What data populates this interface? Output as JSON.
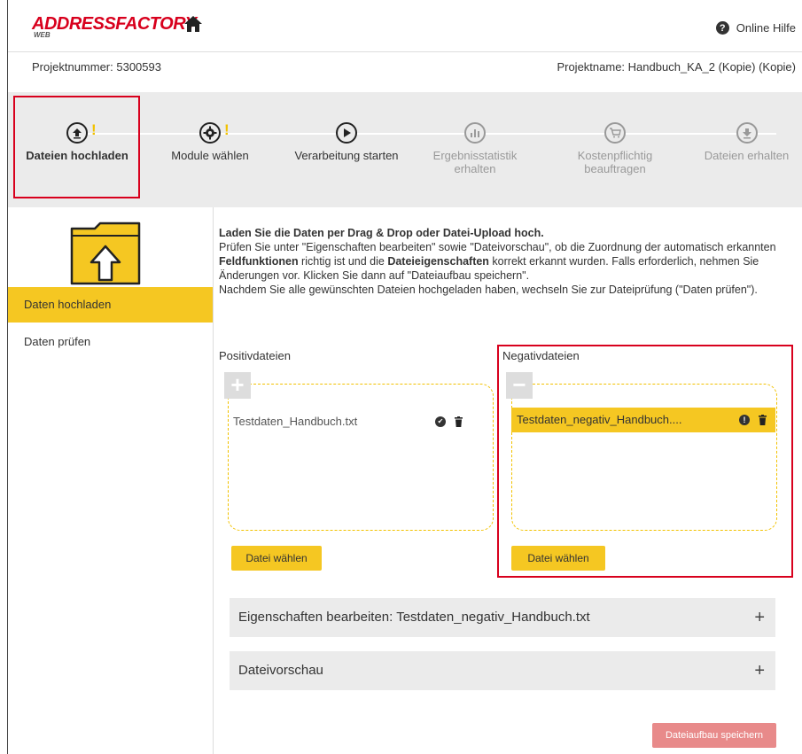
{
  "header": {
    "logo_text": "ADDRESSFACTORY",
    "logo_sub": "WEB",
    "help_label": "Online Hilfe",
    "project_number": "Projektnummer: 5300593",
    "project_name": "Projektname: Handbuch_KA_2 (Kopie) (Kopie)"
  },
  "stepper": {
    "steps": [
      {
        "label": "Dateien hochladen",
        "icon": "upload-icon",
        "state": "active",
        "warning": "!"
      },
      {
        "label": "Module wählen",
        "icon": "gear-icon",
        "state": "normal",
        "warning": "!"
      },
      {
        "label": "Verarbeitung starten",
        "icon": "play-icon",
        "state": "normal"
      },
      {
        "label": "Ergebnisstatistik erhalten",
        "icon": "chart-icon",
        "state": "disabled"
      },
      {
        "label": "Kostenpflichtig beauftragen",
        "icon": "cart-icon",
        "state": "disabled"
      },
      {
        "label": "Dateien erhalten",
        "icon": "download-icon",
        "state": "disabled"
      }
    ]
  },
  "leftnav": {
    "items": [
      {
        "label": "Daten hochladen",
        "active": true
      },
      {
        "label": "Daten prüfen",
        "active": false
      }
    ]
  },
  "intro": {
    "title": "Laden Sie die Daten per Drag & Drop oder Datei-Upload hoch.",
    "p1_a": "Prüfen Sie unter \"Eigenschaften bearbeiten\" sowie \"Dateivorschau\", ob die Zuordnung der automatisch erkannten ",
    "p1_b": "Feldfunktionen",
    "p1_c": " richtig ist und die ",
    "p1_d": "Dateieigenschaften",
    "p1_e": " korrekt erkannt wurden. Falls erforderlich, nehmen Sie Änderungen vor. Klicken Sie dann auf \"Dateiaufbau speichern\".",
    "p2": "Nachdem Sie alle gewünschten Dateien hochgeladen haben, wechseln Sie zur Dateiprüfung (\"Daten prüfen\")."
  },
  "positive": {
    "label": "Positivdateien",
    "add_symbol": "+",
    "file": "Testdaten_Handbuch.txt",
    "choose_label": "Datei wählen"
  },
  "negative": {
    "label": "Negativdateien",
    "remove_symbol": "−",
    "file": "Testdaten_negativ_Handbuch....",
    "choose_label": "Datei wählen"
  },
  "accordions": {
    "properties": "Eigenschaften bearbeiten: Testdaten_negativ_Handbuch.txt",
    "preview": "Dateivorschau",
    "toggle": "+"
  },
  "footer": {
    "save_label": "Dateiaufbau speichern"
  },
  "colors": {
    "brand_red": "#d8001d",
    "accent_yellow": "#f5c722",
    "disabled_save": "#e88a8a"
  }
}
